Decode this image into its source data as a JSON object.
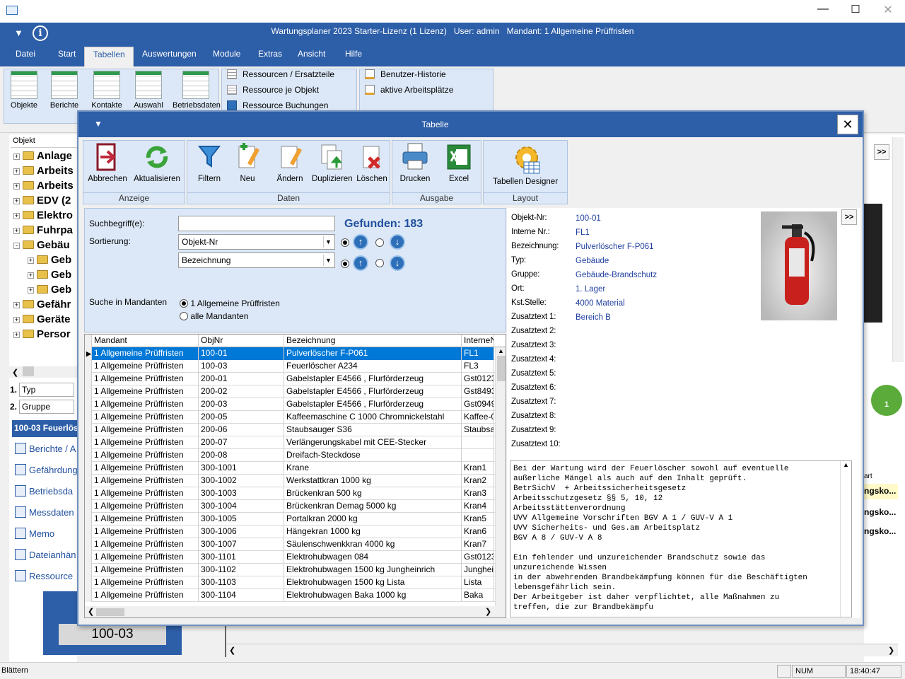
{
  "app": {
    "title": "Wartungsplaner 2023 Starter-Lizenz (1 Lizenz)   User: admin   Mandant: 1 Allgemeine Prüffristen",
    "menu": [
      "Datei",
      "Start",
      "Tabellen",
      "Auswertungen",
      "Module",
      "Extras",
      "Ansicht",
      "Hilfe"
    ],
    "active_menu": "Tabellen"
  },
  "ribbon": {
    "buttons": [
      "Objekte",
      "Berichte",
      "Kontakte",
      "Auswahl",
      "Betriebsdaten"
    ],
    "links_left": [
      "Ressourcen / Ersatzteile",
      "Ressource je Objekt",
      "Ressource Buchungen"
    ],
    "links_right": [
      "Benutzer-Historie",
      "aktive Arbeitsplätze"
    ]
  },
  "left": {
    "tree_header": "Objekt",
    "tree": [
      {
        "label": "Anlage",
        "level": 0,
        "pm": "+"
      },
      {
        "label": "Arbeits",
        "level": 0,
        "pm": "+"
      },
      {
        "label": "Arbeits",
        "level": 0,
        "pm": "+"
      },
      {
        "label": "EDV  (2",
        "level": 0,
        "pm": "+"
      },
      {
        "label": "Elektro",
        "level": 0,
        "pm": "+"
      },
      {
        "label": "Fuhrpa",
        "level": 0,
        "pm": "+"
      },
      {
        "label": "Gebäu",
        "level": 0,
        "pm": "-"
      },
      {
        "label": "Geb",
        "level": 1,
        "pm": "+"
      },
      {
        "label": "Geb",
        "level": 1,
        "pm": "+"
      },
      {
        "label": "Geb",
        "level": 1,
        "pm": "+"
      },
      {
        "label": "Gefähr",
        "level": 0,
        "pm": "+"
      },
      {
        "label": "Geräte",
        "level": 0,
        "pm": "+"
      },
      {
        "label": "Persor",
        "level": 0,
        "pm": "+"
      }
    ],
    "filter1_num": "1.",
    "filter1": "Typ",
    "filter2_num": "2.",
    "filter2": "Gruppe",
    "selected_title": "100-03 Feuerlösc",
    "nav": [
      "Berichte / A",
      "Gefährdung",
      "Betriebsda",
      "Messdaten",
      "Memo",
      "Dateianhän",
      "Ressource"
    ],
    "label_code": "100-03"
  },
  "dialog": {
    "title": "Tabelle",
    "close": "✕",
    "groups": {
      "anzeige": {
        "label": "Anzeige",
        "buttons": [
          "Abbrechen",
          "Aktualisieren"
        ]
      },
      "daten": {
        "label": "Daten",
        "buttons": [
          "Filtern",
          "Neu",
          "Ändern",
          "Duplizieren",
          "Löschen"
        ]
      },
      "ausgabe": {
        "label": "Ausgabe",
        "buttons": [
          "Drucken",
          "Excel"
        ]
      },
      "layout": {
        "label": "Layout",
        "buttons": [
          "Tabellen Designer"
        ]
      }
    },
    "search": {
      "label": "Suchbegriff(e):",
      "value": "",
      "found": "Gefunden: 183",
      "sort_label": "Sortierung:",
      "sort1": "Objekt-Nr",
      "sort2": "Bezeichnung",
      "mandant_label": "Suche in Mandanten",
      "opt1": "1 Allgemeine Prüffristen",
      "opt2": "alle Mandanten"
    },
    "columns": [
      "Mandant",
      "ObjNr",
      "Bezeichnung",
      "InterneN"
    ],
    "rows": [
      [
        "1 Allgemeine Prüffristen",
        "100-01",
        "Pulverlöscher F-P061",
        "FL1"
      ],
      [
        "1 Allgemeine Prüffristen",
        "100-03",
        "Feuerlöscher A234",
        "FL3"
      ],
      [
        "1 Allgemeine Prüffristen",
        "200-01",
        "Gabelstapler E4566 , Flurförderzeug",
        "Gst0123"
      ],
      [
        "1 Allgemeine Prüffristen",
        "200-02",
        "Gabelstapler E4566 , Flurförderzeug",
        "Gst8493"
      ],
      [
        "1 Allgemeine Prüffristen",
        "200-03",
        "Gabelstapler E4566 , Flurförderzeug",
        "Gst0949"
      ],
      [
        "1 Allgemeine Prüffristen",
        "200-05",
        "Kaffeemaschine C 1000 Chromnickelstahl",
        "Kaffee-0"
      ],
      [
        "1 Allgemeine Prüffristen",
        "200-06",
        "Staubsauger S36",
        "Staubsa"
      ],
      [
        "1 Allgemeine Prüffristen",
        "200-07",
        "Verlängerungskabel mit CEE-Stecker",
        ""
      ],
      [
        "1 Allgemeine Prüffristen",
        "200-08",
        "Dreifach-Steckdose",
        ""
      ],
      [
        "1 Allgemeine Prüffristen",
        "300-1001",
        "Krane",
        "Kran1"
      ],
      [
        "1 Allgemeine Prüffristen",
        "300-1002",
        "Werkstattkran 1000 kg",
        "Kran2"
      ],
      [
        "1 Allgemeine Prüffristen",
        "300-1003",
        "Brückenkran 500 kg",
        "Kran3"
      ],
      [
        "1 Allgemeine Prüffristen",
        "300-1004",
        "Brückenkran Demag 5000 kg",
        "Kran4"
      ],
      [
        "1 Allgemeine Prüffristen",
        "300-1005",
        "Portalkran 2000 kg",
        "Kran5"
      ],
      [
        "1 Allgemeine Prüffristen",
        "300-1006",
        "Hängekran 1000 kg",
        "Kran6"
      ],
      [
        "1 Allgemeine Prüffristen",
        "300-1007",
        "Säulenschwenkkran 4000 kg",
        "Kran7"
      ],
      [
        "1 Allgemeine Prüffristen",
        "300-1101",
        "Elektrohubwagen 084",
        "Gst0123"
      ],
      [
        "1 Allgemeine Prüffristen",
        "300-1102",
        "Elektrohubwagen 1500 kg  Jungheinrich",
        "Junghei"
      ],
      [
        "1 Allgemeine Prüffristen",
        "300-1103",
        "Elektrohubwagen 1500 kg Lista",
        "Lista"
      ],
      [
        "1 Allgemeine Prüffristen",
        "300-1104",
        "Elektrohubwagen Baka 1000 kg",
        "Baka"
      ]
    ],
    "selected_row": 0,
    "detail_labels": [
      "Objekt-Nr:",
      "Interne Nr.:",
      "Bezeichnung:",
      "Typ:",
      "Gruppe:",
      "Ort:",
      "Kst.Stelle:",
      "Zusatztext 1:",
      "Zusatztext 2:",
      "Zusatztext 3:",
      "Zusatztext 4:",
      "Zusatztext 5:",
      "Zusatztext 6:",
      "Zusatztext 7:",
      "Zusatztext 8:",
      "Zusatztext 9:",
      "Zusatztext 10:"
    ],
    "detail_values": [
      "100-01",
      "FL1",
      "Pulverlöscher F-P061",
      "Gebäude",
      "Gebäude-Brandschutz",
      "1. Lager",
      "4000 Material",
      "Bereich B",
      "",
      "",
      "",
      "",
      "",
      "",
      "",
      "",
      ""
    ],
    "memo": "Bei der Wartung wird der Feuerlöscher sowohl auf eventuelle\naußerliche Mängel als auch auf den Inhalt geprüft.\nBetrSichV  + Arbeitssicherheitsgesetz\nArbeitsschutzgesetz §§ 5, 10, 12\nArbeitsstättenverordnung\nUVV Allgemeine Vorschriften BGV A 1 / GUV-V A 1\nUVV Sicherheits- und Ges.am Arbeitsplatz\nBGV A 8 / GUV-V A 8\n\nEin fehlender und unzureichender Brandschutz sowie das\nunzureichende Wissen\nin der abwehrenden Brandbekämpfung können für die Beschäftigten\nlebensgefährlich sein.\nDer Arbeitgeber ist daher verpflichtet, alle Maßnahmen zu\ntreffen, die zur Brandbekämpfu",
    "expand": ">>"
  },
  "right": {
    "expand": ">>",
    "col_head": "art",
    "items": [
      "ngsko...",
      "ngsko...",
      "ngsko..."
    ],
    "badge": "1"
  },
  "status": {
    "left": "Blättern",
    "num": "NUM",
    "time": "18:40:47"
  }
}
